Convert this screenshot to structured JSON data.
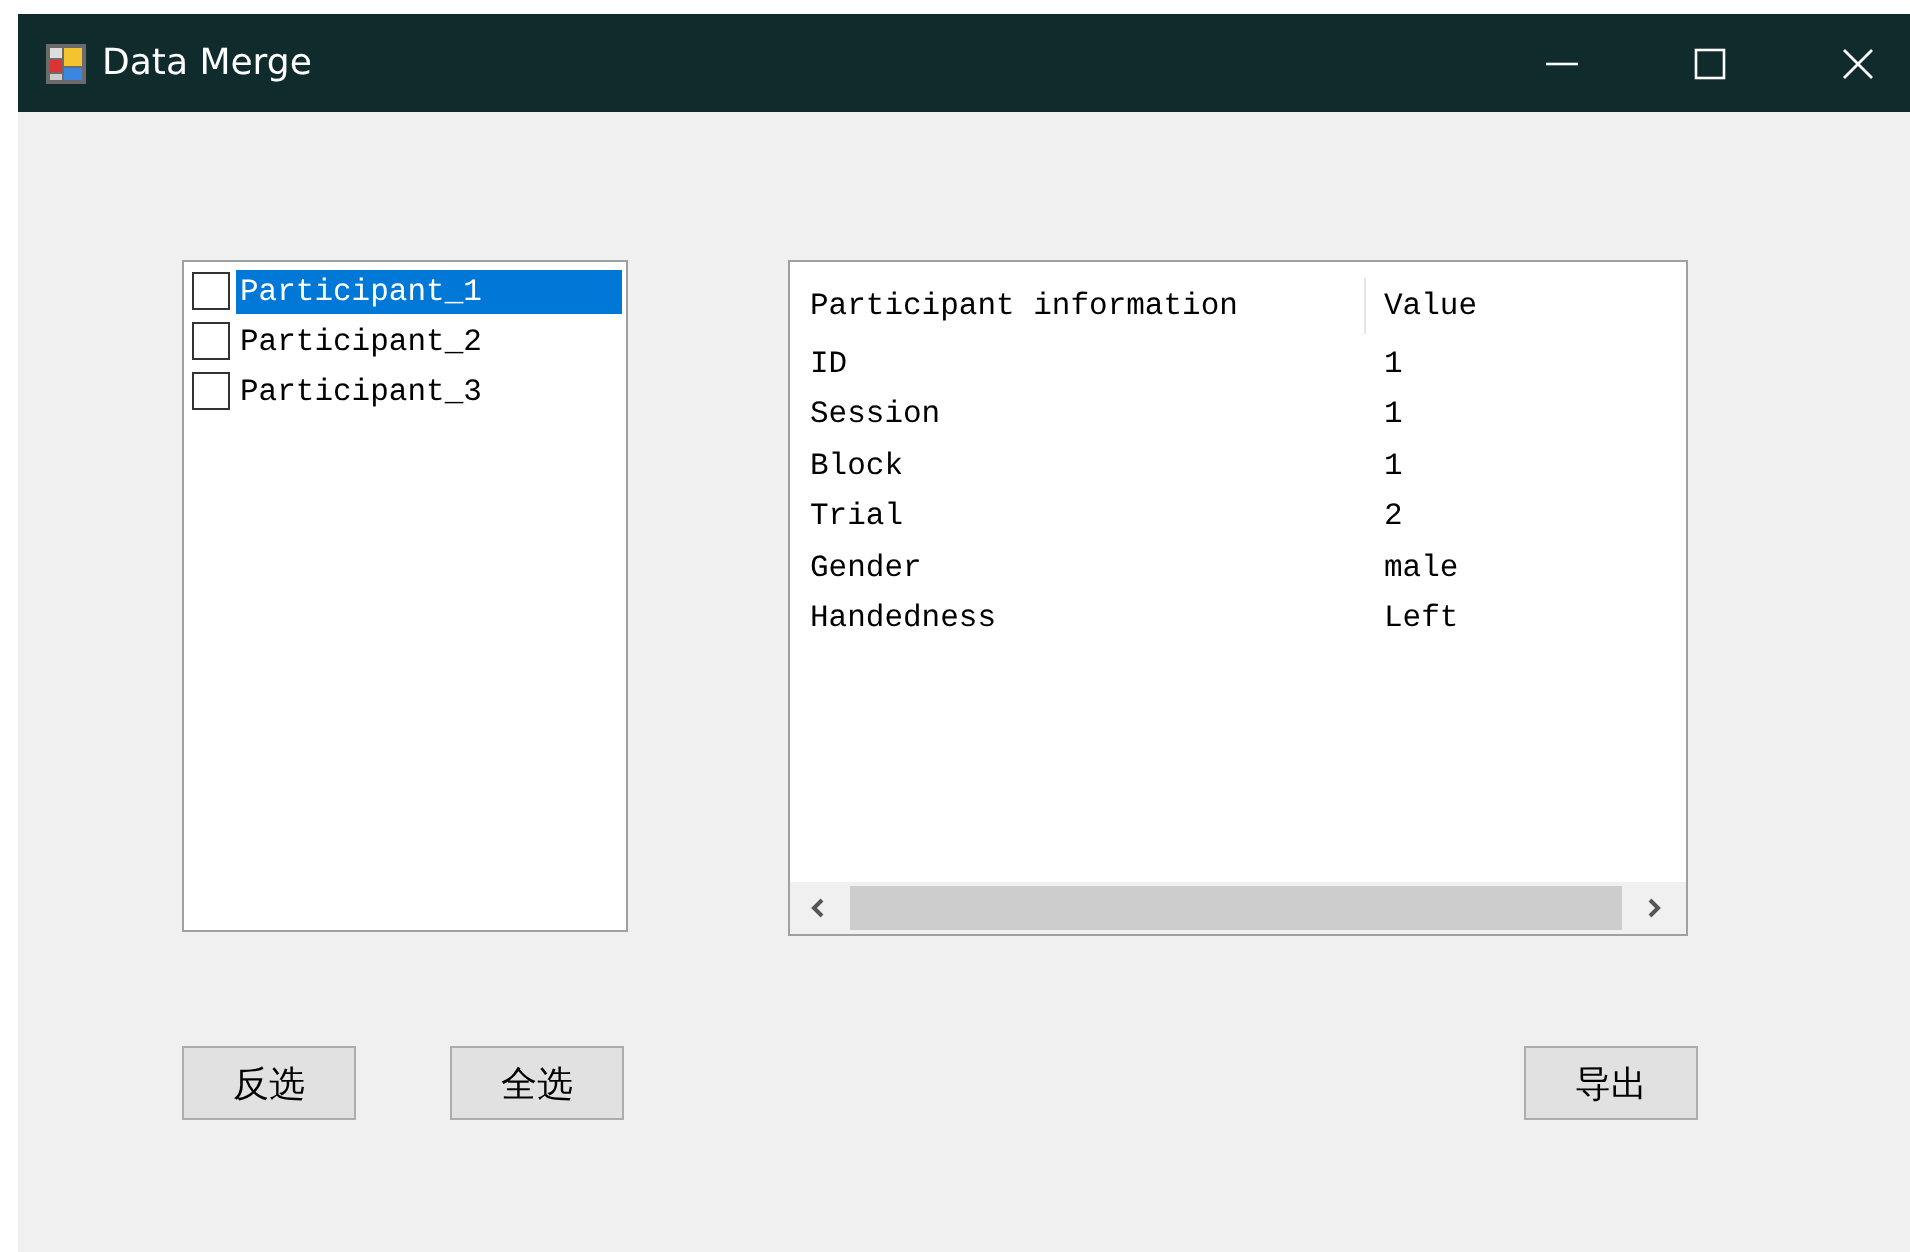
{
  "window": {
    "title": "Data Merge"
  },
  "participants": [
    {
      "label": "Participant_1",
      "checked": false,
      "selected": true
    },
    {
      "label": "Participant_2",
      "checked": false,
      "selected": false
    },
    {
      "label": "Participant_3",
      "checked": false,
      "selected": false
    }
  ],
  "table": {
    "columns": [
      "Participant information",
      "Value"
    ],
    "rows": [
      [
        "ID",
        "1"
      ],
      [
        "Session",
        "1"
      ],
      [
        "Block",
        "1"
      ],
      [
        "Trial",
        "2"
      ],
      [
        "Gender",
        "male"
      ],
      [
        "Handedness",
        "Left"
      ]
    ]
  },
  "buttons": {
    "left": [
      "反选",
      "全选"
    ],
    "right": [
      "导出"
    ]
  }
}
